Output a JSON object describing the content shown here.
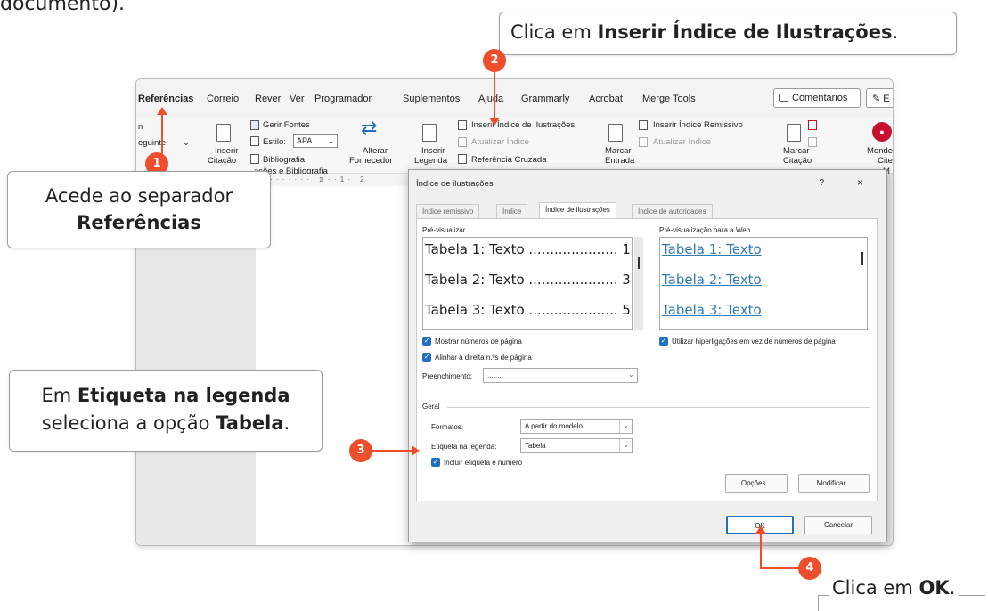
{
  "intro_text": "documento).",
  "menubar": {
    "tabs": [
      "Referências",
      "Correio",
      "Rever",
      "Ver",
      "Programador",
      "Suplementos",
      "Ajuda",
      "Grammarly",
      "Acrobat",
      "Merge Tools"
    ],
    "comentarios": "Comentários",
    "edit_letter": "E"
  },
  "ribbon": {
    "left_partial": "n",
    "seguinte": "eguinte",
    "inserir_citacao_1": "Inserir",
    "inserir_citacao_2": "Citação",
    "gerir_fontes": "Gerir Fontes",
    "estilo": "Estilo:",
    "estilo_value": "APA",
    "bibliografia": "Bibliografia",
    "alterar_1": "Alterar",
    "alterar_2": "Fornecedor",
    "group_label": "ações e Bibliografia",
    "inserir_legenda_1": "Inserir",
    "inserir_legenda_2": "Legenda",
    "inserir_indice_ilustracoes": "Inserir Índice de Ilustrações",
    "atualizar_indice": "Atualizar Índice",
    "referencia_cruzada": "Referência Cruzada",
    "marcar_entrada_1": "Marcar",
    "marcar_entrada_2": "Entrada",
    "inserir_indice_remissivo": "Inserir Índice Remissivo",
    "atualizar_indice_2": "Atualizar Índice",
    "marcar_citacao_1": "Marcar",
    "marcar_citacao_2": "Citação",
    "mende_1": "Mende",
    "mende_2": "Cite",
    "mende_3": "M"
  },
  "ruler_text": "· · · · · · · · ⧖ · · 1 · · 2",
  "dialog": {
    "title": "Índice de ilustrações",
    "help": "?",
    "close": "×",
    "tabs": [
      "Índice remissivo",
      "Índice",
      "Índice de ilustrações",
      "Índice de autoridades"
    ],
    "preview_label": "Pré-visualizar",
    "web_preview_label": "Pré-visualização para a Web",
    "preview_lines": [
      "Tabela 1: Texto ..................... 1",
      "Tabela 2: Texto ..................... 3",
      "Tabela 3: Texto ..................... 5"
    ],
    "web_lines": [
      "Tabela 1: Texto",
      "Tabela 2: Texto",
      "Tabela 3: Texto"
    ],
    "show_page_numbers": "Mostrar números de página",
    "align_right": "Alinhar à direita n.ºs de página",
    "use_hyperlinks": "Utilizar hiperligações em vez de números de página",
    "fill_label": "Preenchimento:",
    "fill_value": "........",
    "geral_label": "Geral",
    "formats_label": "Formatos:",
    "formats_value": "A partir do modelo",
    "caption_label": "Etiqueta na legenda:",
    "caption_value": "Tabela",
    "include_label": "Incluir etiqueta e número",
    "options_btn": "Opções...",
    "modify_btn": "Modificar...",
    "ok_btn": "OK",
    "cancel_btn": "Cancelar"
  },
  "callouts": {
    "c1_line1": "Acede ao separador",
    "c1_line2": "Referências",
    "c2_prefix": "Clica em ",
    "c2_bold": "Inserir Índice de Ilustrações",
    "c2_suffix": ".",
    "c3_l1_prefix": "Em ",
    "c3_l1_bold": "Etiqueta na legenda",
    "c3_l2_prefix": "seleciona a opção ",
    "c3_l2_bold": "Tabela",
    "c3_l2_suffix": ".",
    "c4_prefix": "Clica em ",
    "c4_bold": "OK",
    "c4_suffix": "."
  },
  "badges": [
    "1",
    "2",
    "3",
    "4"
  ],
  "colors": {
    "accent": "#ee4e2c",
    "link": "#2f7bb5",
    "checkbox": "#1f6fc2"
  }
}
